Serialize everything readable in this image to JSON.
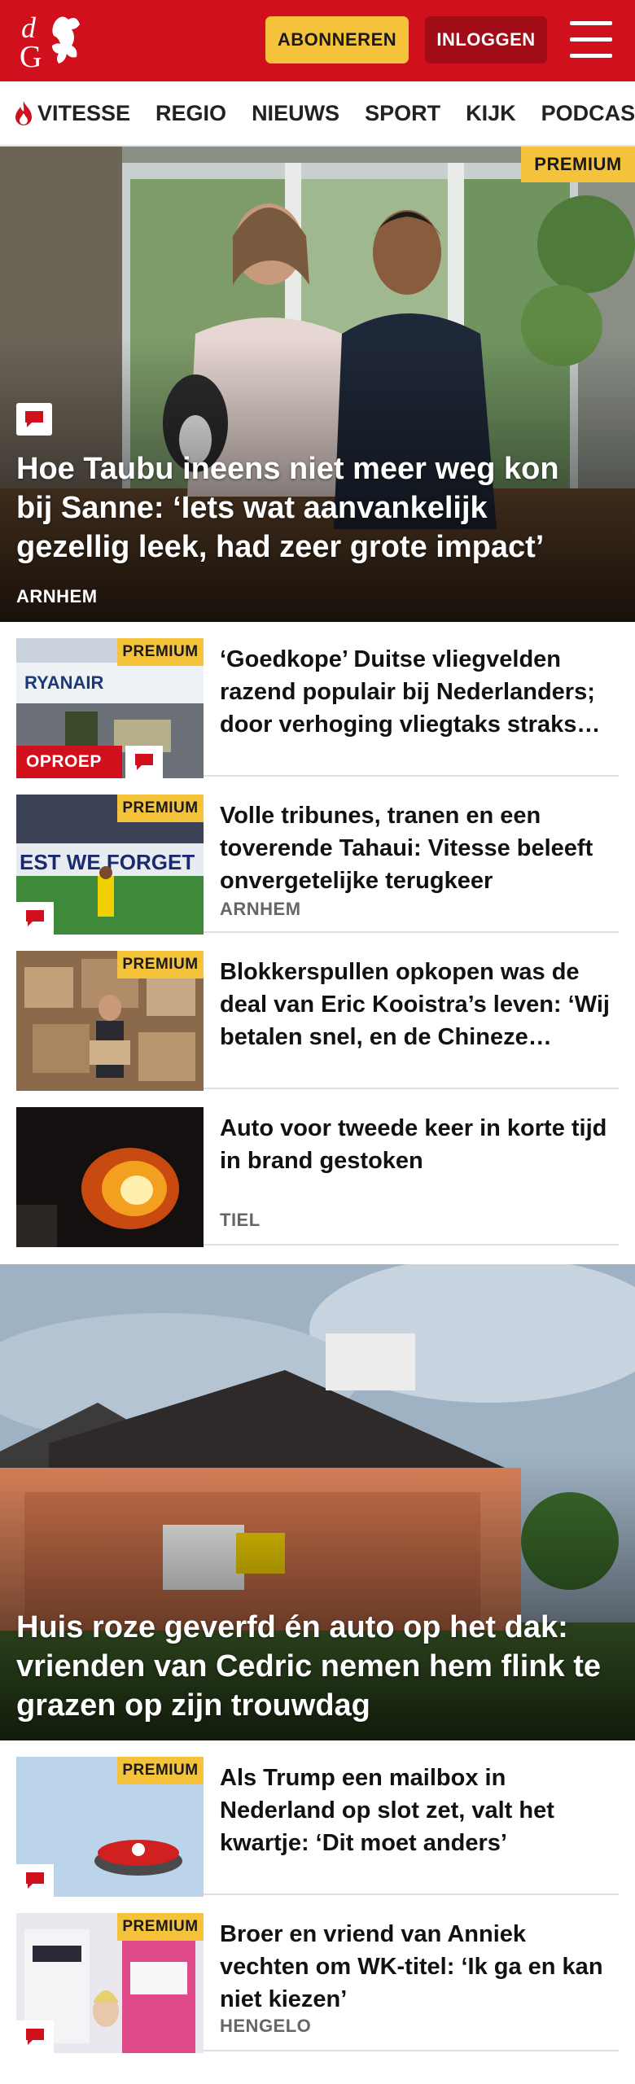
{
  "header": {
    "logo_text": "dG",
    "subscribe_label": "ABONNEREN",
    "login_label": "INLOGGEN",
    "menu_icon": "hamburger-icon",
    "brand_color": "#d0101d"
  },
  "nav": {
    "items": [
      {
        "label": "VITESSE",
        "icon": "flame-icon"
      },
      {
        "label": "REGIO"
      },
      {
        "label": "NIEUWS"
      },
      {
        "label": "SPORT"
      },
      {
        "label": "KIJK"
      },
      {
        "label": "PODCAST"
      }
    ]
  },
  "hero1": {
    "badge": "PREMIUM",
    "title": "Hoe Taubu ineens niet meer weg kon bij Sanne: ‘Iets wat aanvankelijk gezellig leek, had zeer grote impact’",
    "location": "ARNHEM",
    "comment_icon": "comment-icon"
  },
  "articles": [
    {
      "title": "‘Goedkope’ Duitse vliegvelden razend populair bij Nederlanders; door verhoging vliegtaks straks…",
      "badge": "PREMIUM",
      "tag": "OPROEP",
      "location": ""
    },
    {
      "title": "Volle tribunes, tranen en een toverende Tahaui: Vitesse beleeft onvergetelijke terugkeer",
      "badge": "PREMIUM",
      "location": "ARNHEM"
    },
    {
      "title": "Blokkerspullen opkopen was de deal van Eric Kooistra’s leven: ‘Wij betalen snel, en de Chineze…",
      "badge": "PREMIUM",
      "location": ""
    },
    {
      "title": "Auto voor tweede keer in korte tijd in brand gestoken",
      "badge": "",
      "location": "TIEL"
    }
  ],
  "hero2": {
    "title": "Huis roze geverfd én auto op het dak: vrienden van Cedric nemen hem flink te grazen op zijn trouwdag"
  },
  "articles2": [
    {
      "title": "Als Trump een mailbox in Nederland op slot zet, valt het kwartje: ‘Dit moet anders’",
      "badge": "PREMIUM",
      "location": ""
    },
    {
      "title": "Broer en vriend van Anniek vechten om WK-titel: ‘Ik ga en kan niet kiezen’",
      "badge": "PREMIUM",
      "location": "HENGELO"
    }
  ]
}
